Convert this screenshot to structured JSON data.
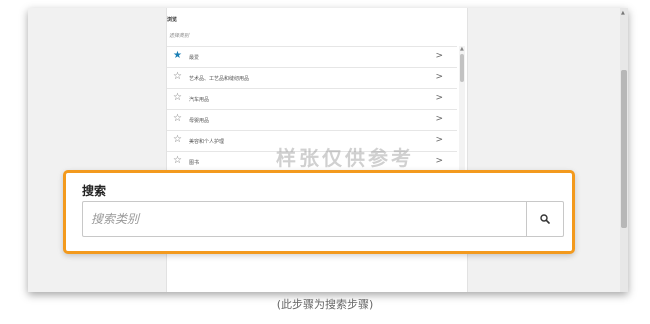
{
  "panel": {
    "title": "浏览",
    "subtitle": "选择类别",
    "categories": [
      {
        "label": "最爱",
        "icon": "star-filled-icon",
        "active": true
      },
      {
        "label": "艺术品、工艺品和缝纫用品",
        "icon": "star-outline-icon",
        "active": false
      },
      {
        "label": "汽车用品",
        "icon": "star-outline-icon",
        "active": false
      },
      {
        "label": "母婴用品",
        "icon": "star-outline-icon",
        "active": false
      },
      {
        "label": "美容和个人护理",
        "icon": "star-outline-icon",
        "active": false
      },
      {
        "label": "图书",
        "icon": "star-outline-icon",
        "active": false
      }
    ]
  },
  "watermark": "样张仅供参考",
  "search": {
    "title": "搜索",
    "placeholder": "搜索类别",
    "button_icon": "search-icon"
  },
  "caption": "(此步骤为搜索步骤)",
  "colors": {
    "highlight": "#f39a1e",
    "accent_star": "#1a7fb5"
  }
}
